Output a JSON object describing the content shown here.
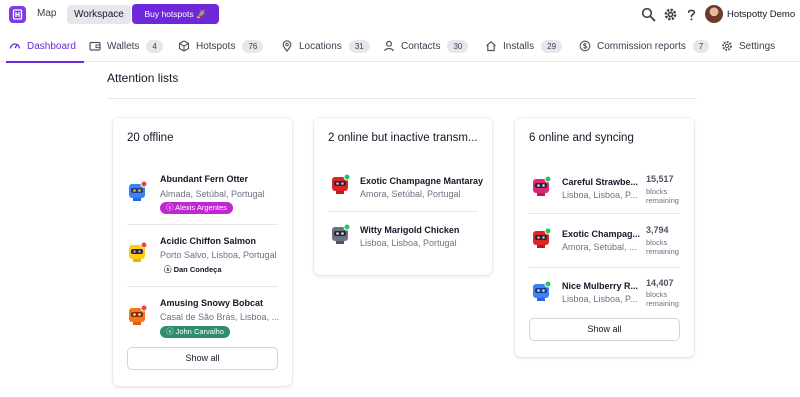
{
  "topbar": {
    "nav_map": "Map",
    "nav_workspace": "Workspace",
    "buy_button": "Buy hotspots 🚀",
    "user_name": "Hotspotty Demo"
  },
  "tabs": [
    {
      "label": "Dashboard",
      "icon": "gauge-icon",
      "count": ""
    },
    {
      "label": "Wallets",
      "icon": "wallet-icon",
      "count": "4"
    },
    {
      "label": "Hotspots",
      "icon": "cube-icon",
      "count": "76"
    },
    {
      "label": "Locations",
      "icon": "map-pin-icon",
      "count": "31"
    },
    {
      "label": "Contacts",
      "icon": "user-icon",
      "count": "30"
    },
    {
      "label": "Installs",
      "icon": "home-icon",
      "count": "29"
    },
    {
      "label": "Commission reports",
      "icon": "dollar-icon",
      "count": "7"
    },
    {
      "label": "Settings",
      "icon": "gear-icon",
      "count": ""
    }
  ],
  "main": {
    "title": "Attention lists"
  },
  "cards": [
    {
      "title": "20 offline",
      "show_all": "Show all",
      "items": [
        {
          "name": "Abundant Fern Otter",
          "location": "Almada, Setúbal, Portugal",
          "tag": "Alexis Argentes",
          "tag_color": "#c026d3"
        },
        {
          "name": "Acidic Chiffon Salmon",
          "location": "Porto Salvo, Lisboa, Portugal",
          "tag": "Dan Condeça",
          "tag_color": ""
        },
        {
          "name": "Amusing Snowy Bobcat",
          "location": "Casal de São Brás, Lisboa, ...",
          "tag": "John Carvalho",
          "tag_color": "#2f8f6a"
        }
      ]
    },
    {
      "title": "2 online but inactive transm...",
      "items": [
        {
          "name": "Exotic Champagne Mantaray",
          "location": "Amora, Setúbal, Portugal"
        },
        {
          "name": "Witty Marigold Chicken",
          "location": "Lisboa, Lisboa, Portugal"
        }
      ]
    },
    {
      "title": "6 online and syncing",
      "show_all": "Show all",
      "items": [
        {
          "name": "Careful Strawbe...",
          "location": "Lisboa, Lisboa, P...",
          "blocks": "15,517",
          "blocks_label": "blocks remaining"
        },
        {
          "name": "Exotic Champag...",
          "location": "Amora, Setúbal, ...",
          "blocks": "3,794",
          "blocks_label": "blocks remaining"
        },
        {
          "name": "Nice Mulberry R...",
          "location": "Lisboa, Lisboa, P...",
          "blocks": "14,407",
          "blocks_label": "blocks remaining"
        }
      ]
    }
  ],
  "colors": {
    "accent": "#6d28d9",
    "online_dot": "#22c55e",
    "offline_dot": "#ef4444"
  }
}
